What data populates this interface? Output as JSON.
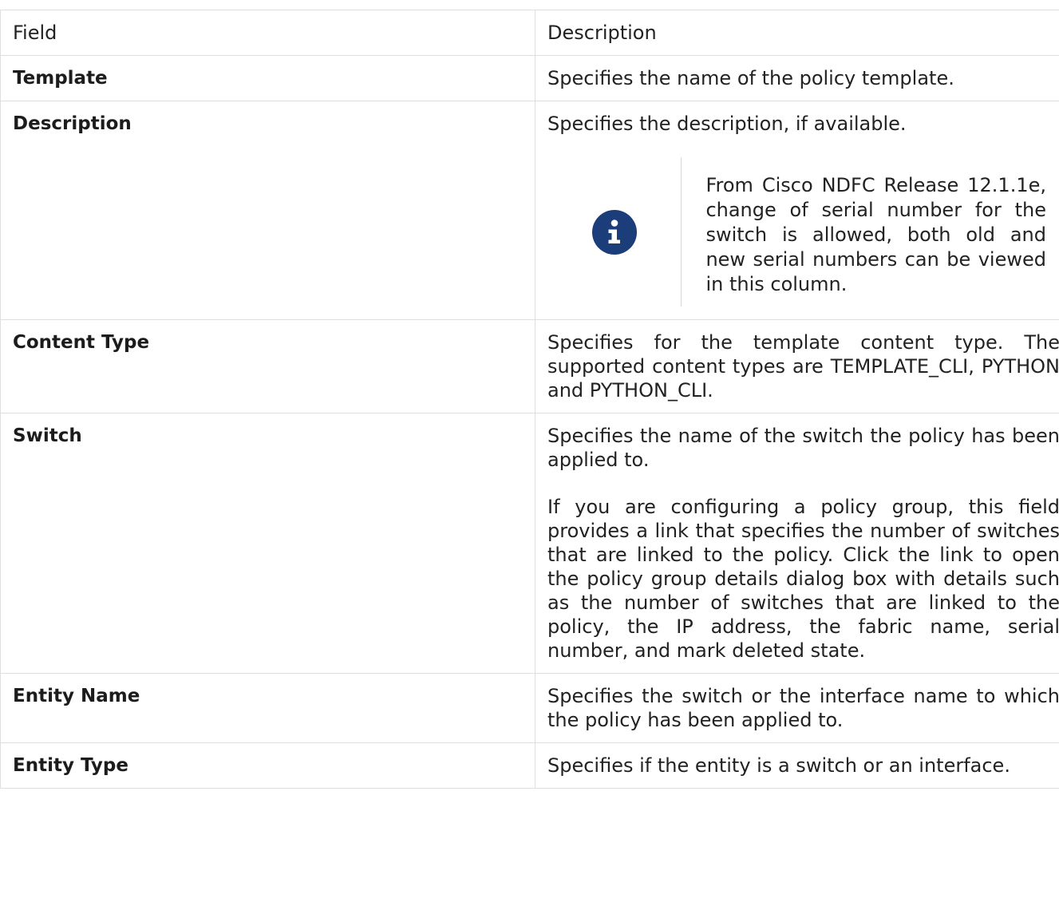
{
  "table": {
    "headers": [
      "Field",
      "Description"
    ],
    "rows": [
      {
        "field": "Template",
        "description": [
          "Specifies the name of the policy template."
        ]
      },
      {
        "field": "Description",
        "description": [
          "Specifies the description, if available."
        ],
        "note": "From Cisco NDFC Release 12.1.1e, change of serial number for the switch is allowed, both old and new serial numbers can be viewed in this column."
      },
      {
        "field": "Content Type",
        "description": [
          "Specifies for the template content type. The supported content types are TEMPLATE_CLI, PYTHON and PYTHON_CLI."
        ]
      },
      {
        "field": "Switch",
        "description": [
          "Specifies the name of the switch the policy has been applied to.",
          "If you are configuring a policy group, this field provides a link that specifies the number of switches that are linked to the policy. Click the link to open the policy group details dialog box with details such as the number of switches that are linked to the policy, the IP address, the fabric name, serial number, and mark deleted state."
        ]
      },
      {
        "field": "Entity Name",
        "description": [
          "Specifies the switch or the interface name to which the policy has been applied to."
        ]
      },
      {
        "field": "Entity Type",
        "description": [
          "Specifies if the entity is a switch or an interface."
        ]
      }
    ]
  },
  "icons": {
    "note": "info-icon"
  }
}
